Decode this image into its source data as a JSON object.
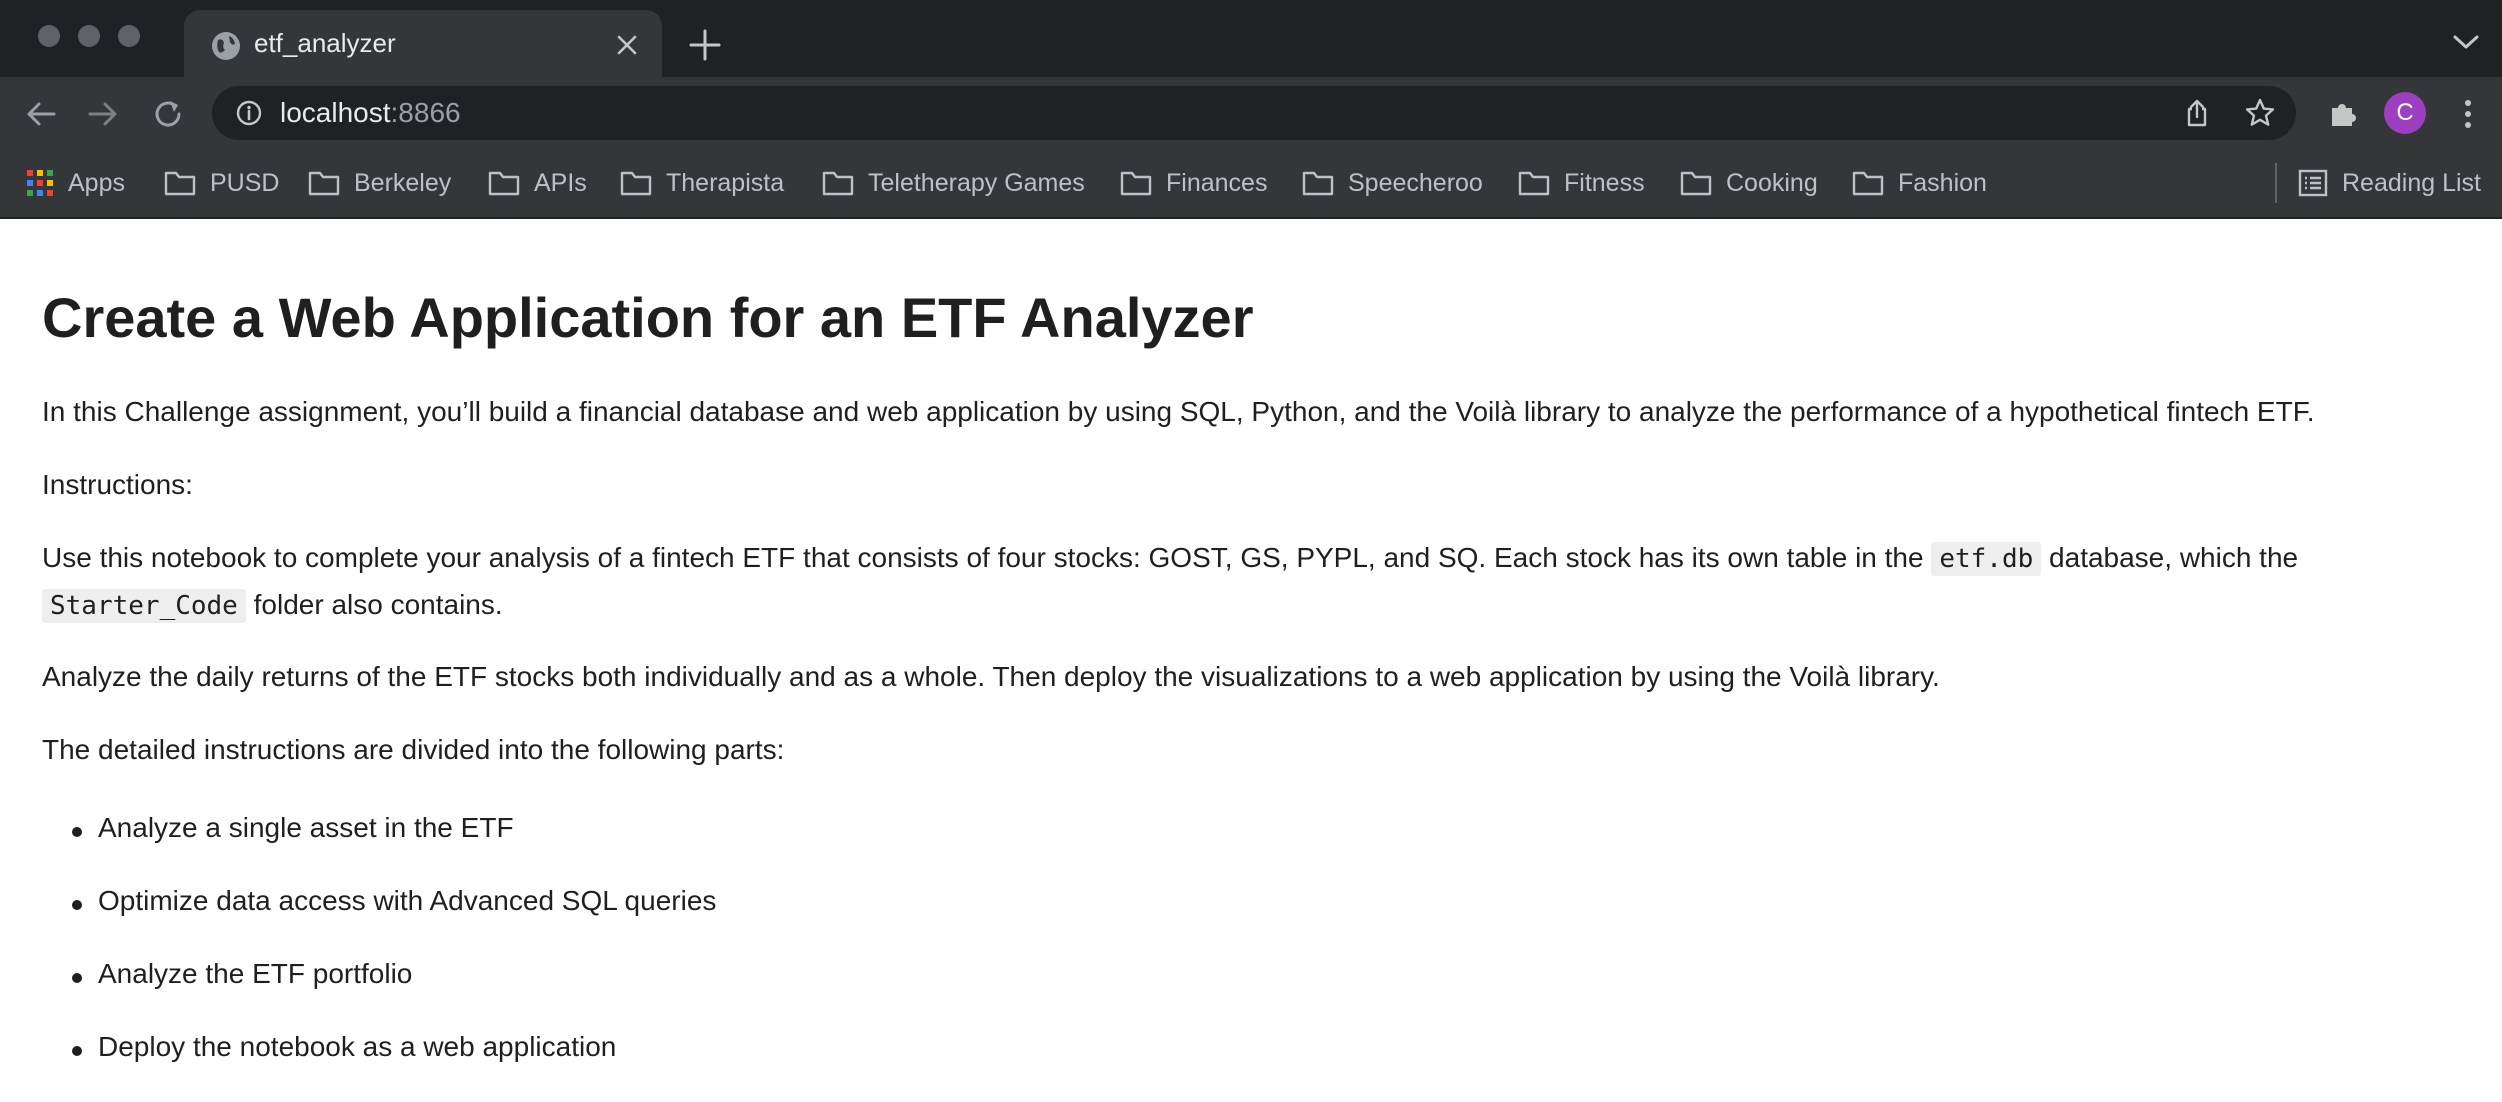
{
  "browser": {
    "tab": {
      "title": "etf_analyzer"
    },
    "address_bar": {
      "host": "localhost",
      "port": ":8866"
    },
    "profile_initial": "C",
    "bookmarks": [
      "Apps",
      "PUSD",
      "Berkeley",
      "APIs",
      "Therapista",
      "Teletherapy Games",
      "Finances",
      "Speecheroo",
      "Fitness",
      "Cooking",
      "Fashion"
    ],
    "reading_list": "Reading List"
  },
  "page": {
    "title": "Create a Web Application for an ETF Analyzer",
    "intro": "In this Challenge assignment, you’ll build a financial database and web application by using SQL, Python, and the Voilà library to analyze the performance of a hypothetical fintech ETF.",
    "instructions_label": "Instructions:",
    "notebook_para": {
      "part1": "Use this notebook to complete your analysis of a fintech ETF that consists of four stocks: GOST, GS, PYPL, and SQ. Each stock has its own table in the ",
      "code1": "etf.db",
      "part2": " database, which the",
      "code2": "Starter_Code",
      "part3": " folder also contains."
    },
    "analyze_para": "Analyze the daily returns of the ETF stocks both individually and as a whole. Then deploy the visualizations to a web application by using the Voilà library.",
    "parts_intro": "The detailed instructions are divided into the following parts:",
    "parts": [
      "Analyze a single asset in the ETF",
      "Optimize data access with Advanced SQL queries",
      "Analyze the ETF portfolio",
      "Deploy the notebook as a web application"
    ]
  }
}
